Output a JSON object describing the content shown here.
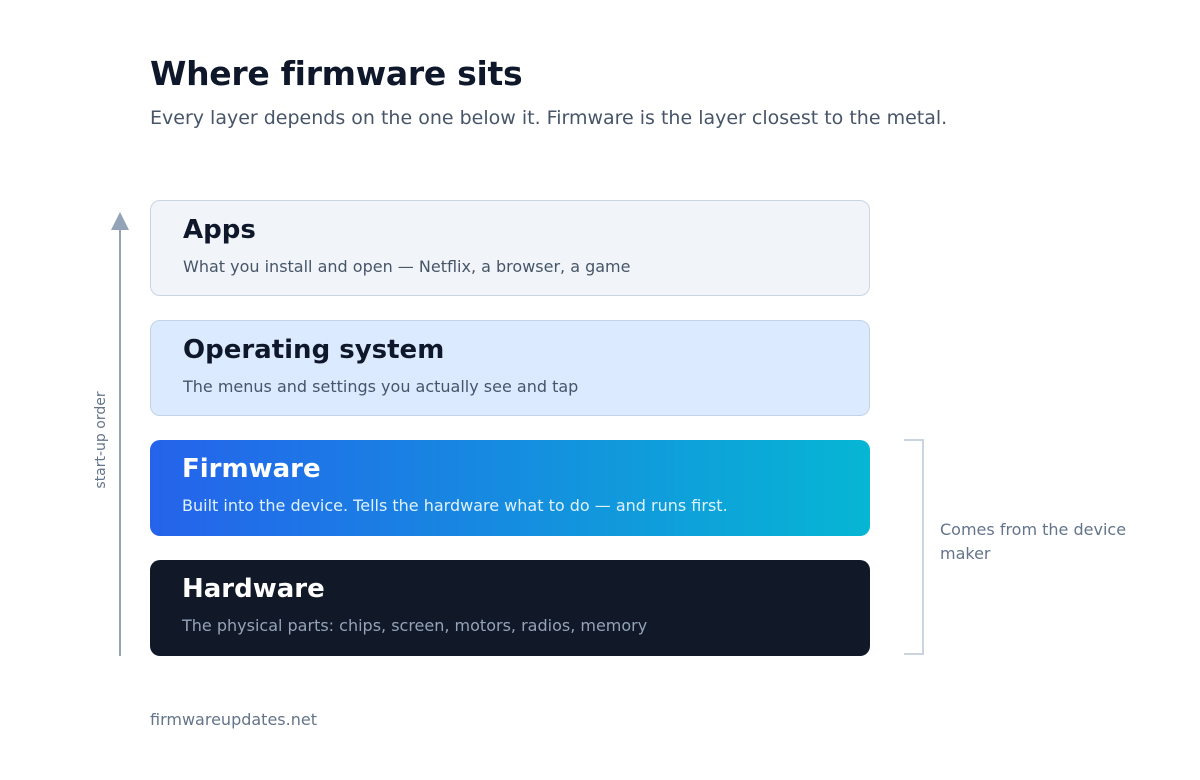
{
  "header": {
    "title": "Where firmware sits",
    "subtitle": "Every layer depends on the one below it. Firmware is the layer closest to the metal."
  },
  "stack": {
    "axis_label": "start-up order",
    "layers": [
      {
        "name": "Apps",
        "description": "What you install and open — Netflix, a browser, a game"
      },
      {
        "name": "Operating system",
        "description": "The menus and settings you actually see and tap"
      },
      {
        "name": "Firmware",
        "description": "Built into the device. Tells the hardware what to do — and runs first."
      },
      {
        "name": "Hardware",
        "description": "The physical parts: chips, screen, motors, radios, memory"
      }
    ]
  },
  "bracket": {
    "note": "Comes from the device maker"
  },
  "footer": {
    "source": "firmwareupdates.net"
  },
  "colors": {
    "firmware_gradient_start": "#2563eb",
    "firmware_gradient_end": "#06b6d4",
    "hardware": "#111827",
    "os": "#dbeafe",
    "apps": "#f1f5f9"
  }
}
